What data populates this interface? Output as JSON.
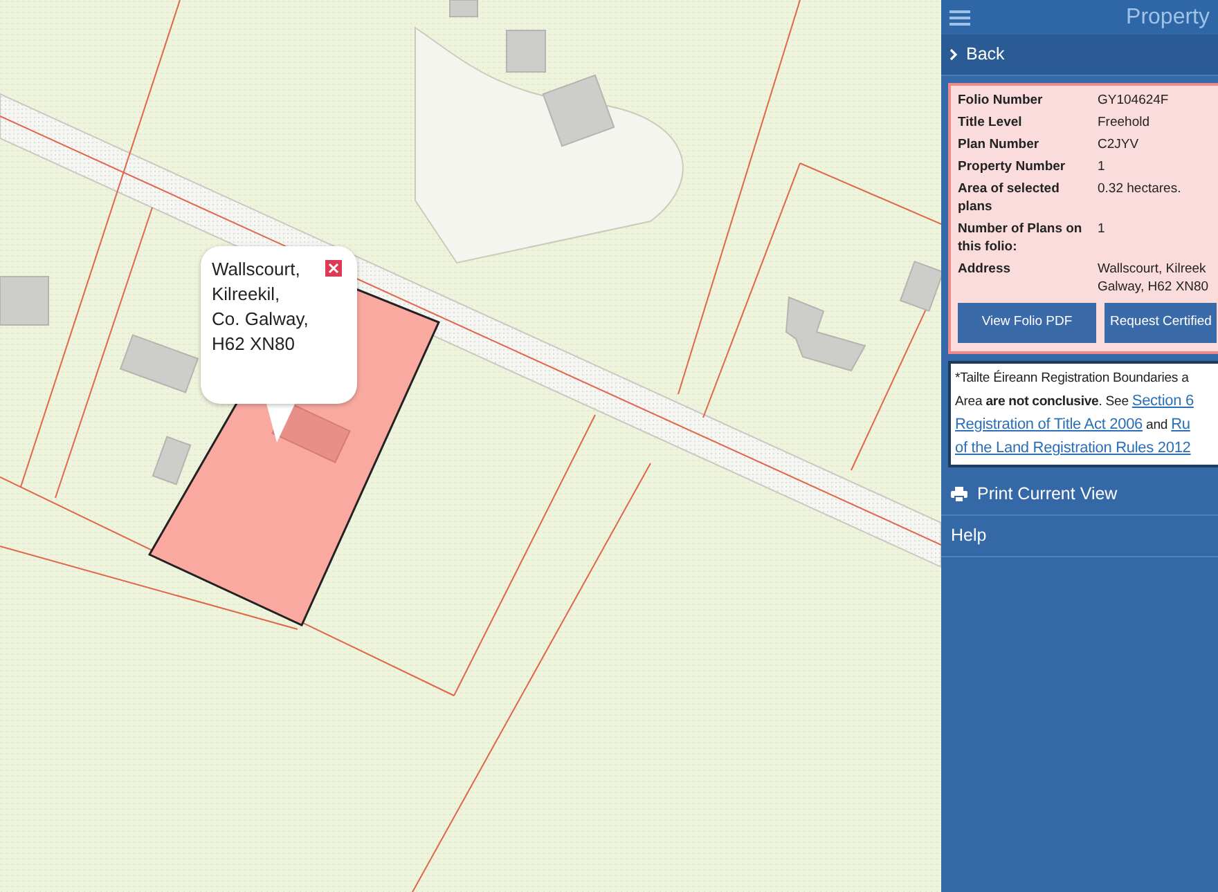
{
  "map": {
    "popup": {
      "lines": [
        "Wallscourt,",
        "Kilreekil,",
        "Co. Galway,",
        "H62 XN80"
      ]
    }
  },
  "header": {
    "title": "Property"
  },
  "back": {
    "label": "Back"
  },
  "folio": {
    "rows": [
      {
        "label": "Folio Number",
        "value": [
          "GY104624F"
        ]
      },
      {
        "label": "Title Level",
        "value": [
          "Freehold"
        ]
      },
      {
        "label": "Plan Number",
        "value": [
          "C2JYV"
        ]
      },
      {
        "label": "Property Number",
        "value": [
          "1"
        ]
      },
      {
        "label": "Area of selected plans",
        "value": [
          "0.32 hectares."
        ]
      },
      {
        "label": "Number of Plans on this folio:",
        "value": [
          "1"
        ]
      },
      {
        "label": "Address",
        "value": [
          "Wallscourt, Kilreek",
          "Galway, H62 XN80"
        ]
      }
    ],
    "buttons": [
      "View Folio PDF",
      "Request Certified"
    ]
  },
  "note": {
    "lines": [
      [
        {
          "kind": "text",
          "text": "*Tailte Éireann Registration Boundaries a"
        }
      ],
      [
        {
          "kind": "text",
          "text": "Area **are not conclusive**. See "
        },
        {
          "kind": "link",
          "text": "Section 6"
        }
      ],
      [
        {
          "kind": "link",
          "text": "Registration of Title Act 2006"
        },
        {
          "kind": "text",
          "text": " and "
        },
        {
          "kind": "link",
          "text": "Ru"
        }
      ],
      [
        {
          "kind": "link",
          "text": "of the Land Registration Rules 2012"
        }
      ]
    ]
  },
  "menu": [
    {
      "kind": "print",
      "label": "Print Current View"
    },
    {
      "kind": "plain",
      "label": "Help"
    }
  ]
}
